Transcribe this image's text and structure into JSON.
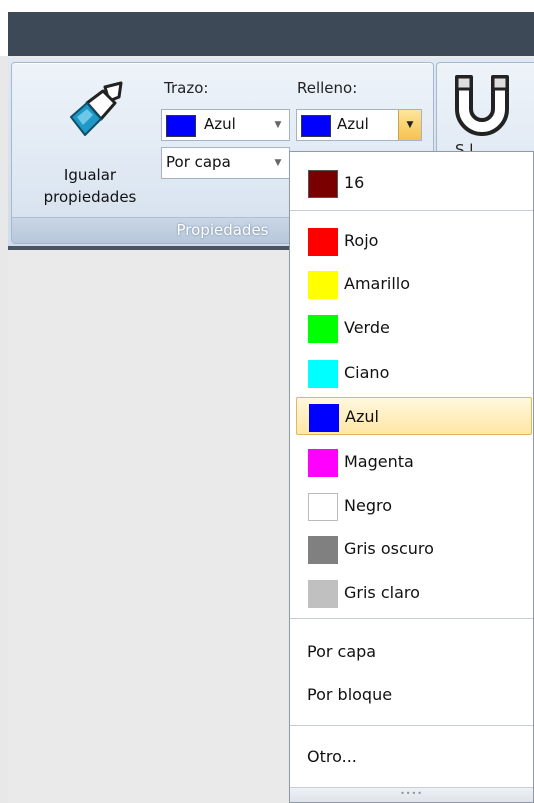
{
  "ribbon": {
    "match_properties_label_line1": "Igualar",
    "match_properties_label_line2": "propiedades",
    "stroke_label": "Trazo:",
    "fill_label": "Relleno:",
    "stroke_color_value": "Azul",
    "fill_color_value": "Azul",
    "linetype_value": "Por capa",
    "group_caption": "Propiedades",
    "next_group_partial_label": "S   l"
  },
  "colors": {
    "stroke_swatch": "#0000ff",
    "fill_swatch": "#0000ff",
    "selection_highlight": "#ffe7a4"
  },
  "dropdown": {
    "recent": [
      {
        "label": "16",
        "color": "#7a0000"
      }
    ],
    "items": [
      {
        "label": "Rojo",
        "color": "#ff0000"
      },
      {
        "label": "Amarillo",
        "color": "#ffff00"
      },
      {
        "label": "Verde",
        "color": "#00ff00"
      },
      {
        "label": "Ciano",
        "color": "#00ffff"
      },
      {
        "label": "Azul",
        "color": "#0000ff",
        "selected": true
      },
      {
        "label": "Magenta",
        "color": "#ff00ff"
      },
      {
        "label": "Negro",
        "color": "#ffffff"
      },
      {
        "label": "Gris oscuro",
        "color": "#808080"
      },
      {
        "label": "Gris claro",
        "color": "#c0c0c0"
      }
    ],
    "by_layer": "Por capa",
    "by_block": "Por bloque",
    "other": "Otro...",
    "grip": "••••"
  }
}
